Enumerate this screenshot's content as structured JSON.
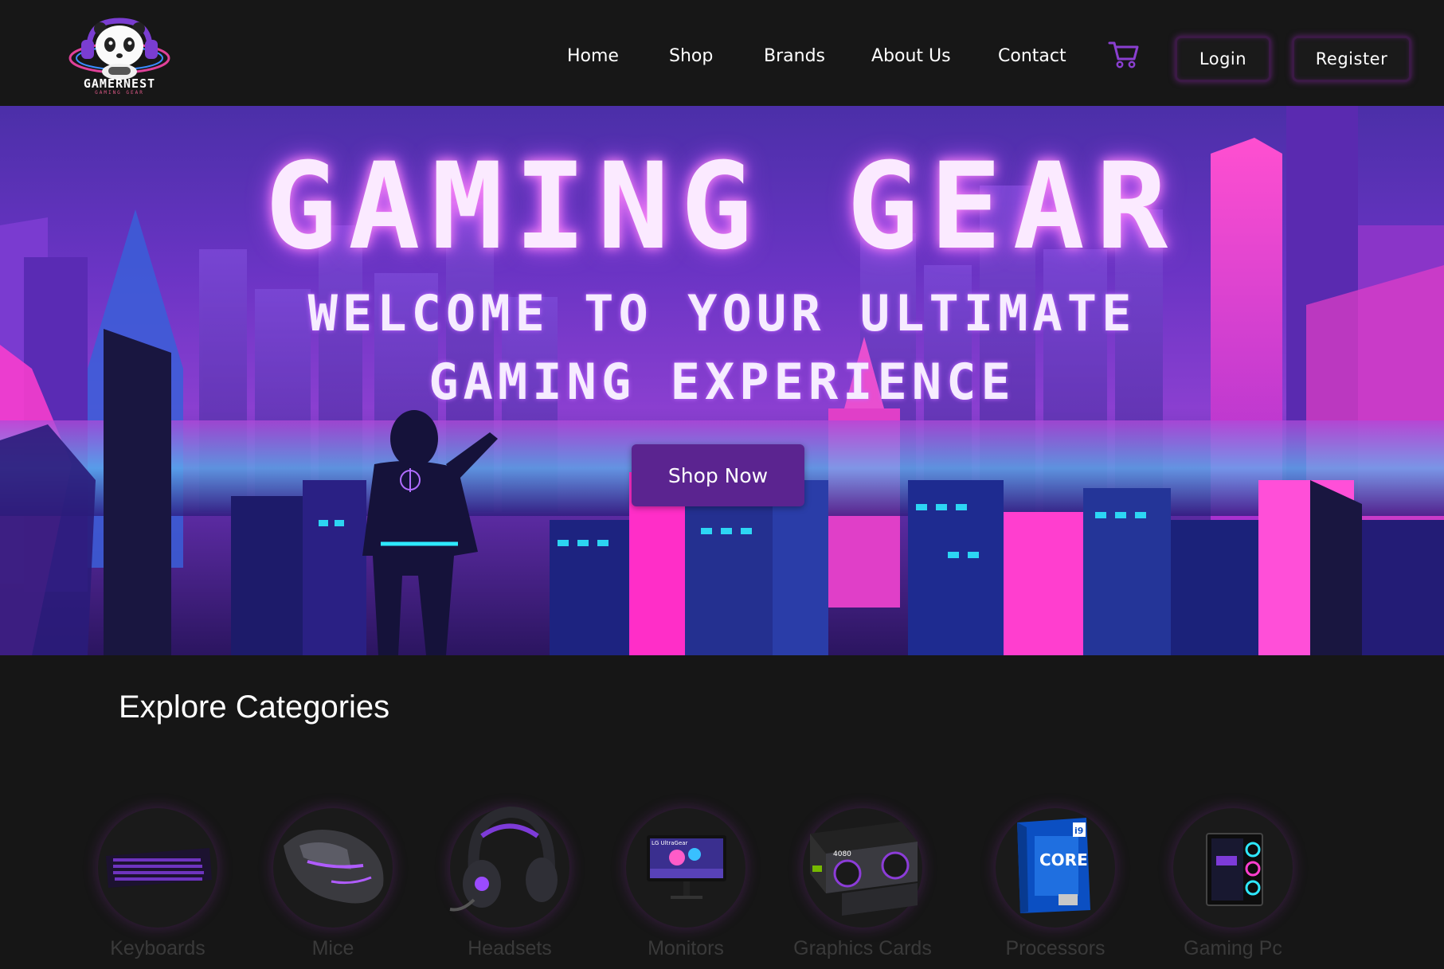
{
  "brand": {
    "name": "GAMERNEST",
    "tagline": "GAMING GEAR"
  },
  "nav": {
    "items": [
      "Home",
      "Shop",
      "Brands",
      "About Us",
      "Contact"
    ],
    "login": "Login",
    "register": "Register"
  },
  "hero": {
    "title": "GAMING GEAR",
    "subtitle_line1": "WELCOME TO YOUR ULTIMATE",
    "subtitle_line2": "GAMING EXPERIENCE",
    "cta": "Shop Now"
  },
  "categories": {
    "title": "Explore Categories",
    "items": [
      "Keyboards",
      "Mice",
      "Headsets",
      "Monitors",
      "Graphics Cards",
      "Processors",
      "Gaming Pc"
    ]
  },
  "product_brand_marks": {
    "monitor": "LG UltraGear",
    "gpu": "4080",
    "cpu": "CORE",
    "cpu_tier": "i9"
  },
  "colors": {
    "accent": "#5b2490",
    "header_bg": "#171717",
    "page_bg": "#161616",
    "neon_pink": "#ff3ecf",
    "neon_cyan": "#27e0ff"
  }
}
